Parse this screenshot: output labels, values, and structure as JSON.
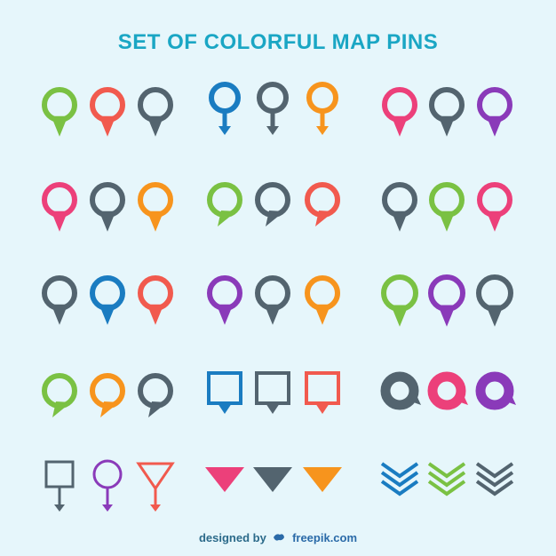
{
  "title": "SET OF COLORFUL MAP PINS",
  "footer": {
    "designed_by": "designed by",
    "brand": "freepik.com",
    "brand_icon": "freepik-logo-icon"
  },
  "colors": {
    "green": "#7ac143",
    "red": "#f15a4e",
    "pink": "#ec407a",
    "gray": "#53646f",
    "blue": "#1a7cc1",
    "orange": "#f7941d",
    "purple": "#8a3ab9"
  },
  "rows": [
    [
      {
        "type": "drop",
        "colors": [
          "green",
          "red",
          "gray"
        ]
      },
      {
        "type": "ring-arrow",
        "colors": [
          "blue",
          "gray",
          "orange"
        ]
      },
      {
        "type": "drop",
        "colors": [
          "pink",
          "gray",
          "purple"
        ]
      }
    ],
    [
      {
        "type": "drop",
        "colors": [
          "pink",
          "gray",
          "orange"
        ]
      },
      {
        "type": "bubble",
        "colors": [
          "green",
          "gray",
          "red"
        ]
      },
      {
        "type": "drop",
        "colors": [
          "gray",
          "green",
          "pink"
        ]
      }
    ],
    [
      {
        "type": "bubble-left",
        "colors": [
          "gray",
          "blue",
          "red"
        ]
      },
      {
        "type": "drop",
        "colors": [
          "purple",
          "gray",
          "orange"
        ]
      },
      {
        "type": "drop-wide",
        "colors": [
          "green",
          "purple",
          "gray"
        ]
      }
    ],
    [
      {
        "type": "bubble",
        "colors": [
          "green",
          "orange",
          "gray"
        ]
      },
      {
        "type": "square",
        "colors": [
          "blue",
          "gray",
          "red"
        ]
      },
      {
        "type": "ring-thick",
        "colors": [
          "gray",
          "pink",
          "purple"
        ]
      }
    ],
    [
      {
        "type": "symbols",
        "items": [
          {
            "shape": "square-arrow",
            "color": "gray"
          },
          {
            "shape": "circle-arrow",
            "color": "purple"
          },
          {
            "shape": "triangle-stem",
            "color": "red"
          }
        ]
      },
      {
        "type": "chevron-tri",
        "colors": [
          "pink",
          "gray",
          "orange"
        ]
      },
      {
        "type": "chevron-triple",
        "colors": [
          "blue",
          "green",
          "gray"
        ]
      }
    ]
  ]
}
